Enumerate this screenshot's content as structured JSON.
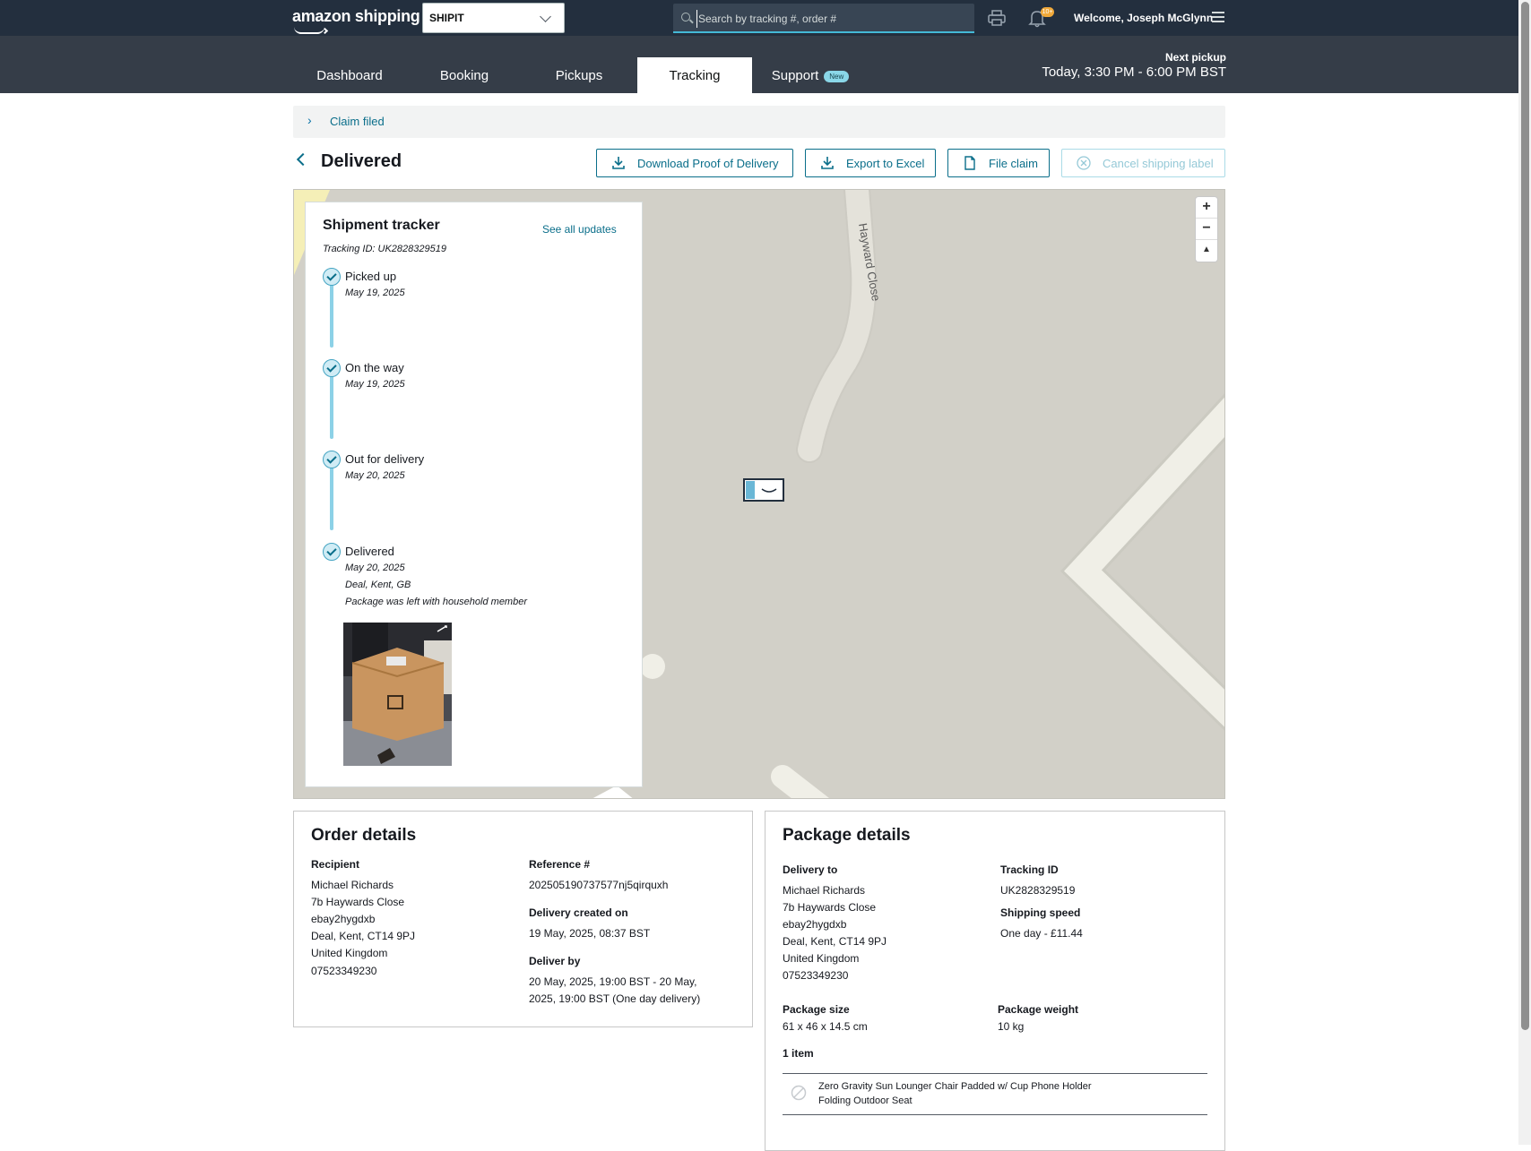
{
  "header": {
    "brand": "amazon shipping",
    "account": "SHIPIT",
    "search_placeholder": "Search by tracking #, order #",
    "notifications_badge": "10+",
    "welcome": "Welcome, Joseph McGlynn"
  },
  "nav": {
    "tabs": [
      {
        "label": "Dashboard"
      },
      {
        "label": "Booking"
      },
      {
        "label": "Pickups"
      },
      {
        "label": "Tracking"
      },
      {
        "label": "Support",
        "badge": "New"
      }
    ],
    "active_tab": "Tracking",
    "next_pickup_label": "Next pickup",
    "next_pickup_value": "Today, 3:30 PM - 6:00 PM BST"
  },
  "claim_bar": {
    "text": "Claim filed"
  },
  "page": {
    "title": "Delivered",
    "actions": {
      "download_pod": "Download Proof of Delivery",
      "export_excel": "Export to Excel",
      "file_claim": "File claim",
      "cancel_label": "Cancel shipping label"
    }
  },
  "map": {
    "street_label": "Hayward Close"
  },
  "tracker": {
    "title": "Shipment tracker",
    "tracking_id": "Tracking ID: UK2828329519",
    "see_all": "See all updates",
    "steps": [
      {
        "title": "Picked up",
        "date": "May 19, 2025"
      },
      {
        "title": "On the way",
        "date": "May 19, 2025"
      },
      {
        "title": "Out for delivery",
        "date": "May 20, 2025"
      },
      {
        "title": "Delivered",
        "date": "May 20, 2025",
        "location": "Deal, Kent, GB",
        "note": "Package was left with household member"
      }
    ]
  },
  "order_details": {
    "title": "Order details",
    "recipient_label": "Recipient",
    "recipient_lines": [
      "Michael Richards",
      "7b Haywards Close",
      "ebay2hygdxb",
      "Deal, Kent, CT14 9PJ",
      "United Kingdom",
      "07523349230"
    ],
    "reference_label": "Reference #",
    "reference_value": "202505190737577nj5qirquxh",
    "created_label": "Delivery created on",
    "created_value": "19 May, 2025, 08:37 BST",
    "deliver_by_label": "Deliver by",
    "deliver_by_line1": "20 May, 2025, 19:00 BST - 20 May,",
    "deliver_by_line2": "2025, 19:00 BST (One day delivery)"
  },
  "package_details": {
    "title": "Package details",
    "delivery_to_label": "Delivery to",
    "delivery_to_lines": [
      "Michael Richards",
      "7b Haywards Close",
      "ebay2hygdxb",
      "Deal, Kent, CT14 9PJ",
      "United Kingdom",
      "07523349230"
    ],
    "tracking_id_label": "Tracking ID",
    "tracking_id_value": "UK2828329519",
    "shipping_speed_label": "Shipping speed",
    "shipping_speed_value": "One day - £11.44",
    "size_label": "Package size",
    "size_value": "61 x 46 x 14.5 cm",
    "weight_label": "Package weight",
    "weight_value": "10 kg",
    "items_count": "1 item",
    "item_name_line1": "Zero Gravity Sun Lounger Chair Padded w/ Cup Phone Holder",
    "item_name_line2": "Folding Outdoor Seat"
  },
  "colors": {
    "topbar": "#232f3e",
    "navbar": "#353d48",
    "link": "#0a6e8a",
    "timeline": "#8cd1e7",
    "map_bg": "#d2d0c8"
  }
}
